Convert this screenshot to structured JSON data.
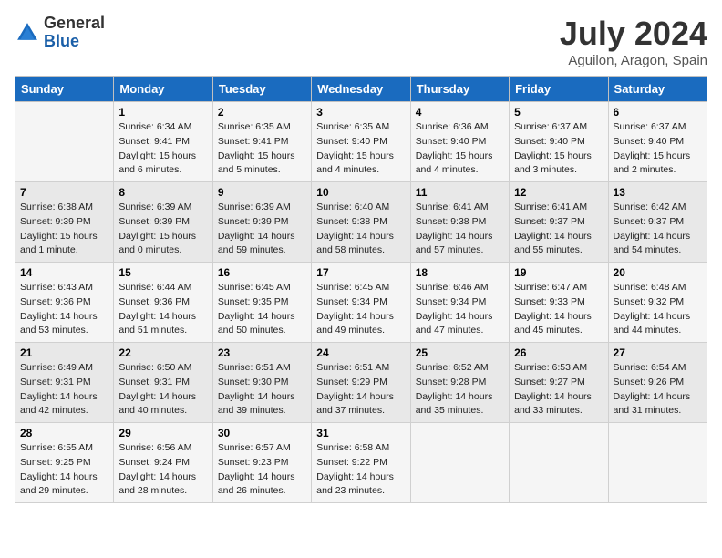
{
  "header": {
    "logo_general": "General",
    "logo_blue": "Blue",
    "month_year": "July 2024",
    "location": "Aguilon, Aragon, Spain"
  },
  "days_of_week": [
    "Sunday",
    "Monday",
    "Tuesday",
    "Wednesday",
    "Thursday",
    "Friday",
    "Saturday"
  ],
  "weeks": [
    [
      {
        "day": "",
        "info": ""
      },
      {
        "day": "1",
        "info": "Sunrise: 6:34 AM\nSunset: 9:41 PM\nDaylight: 15 hours\nand 6 minutes."
      },
      {
        "day": "2",
        "info": "Sunrise: 6:35 AM\nSunset: 9:41 PM\nDaylight: 15 hours\nand 5 minutes."
      },
      {
        "day": "3",
        "info": "Sunrise: 6:35 AM\nSunset: 9:40 PM\nDaylight: 15 hours\nand 4 minutes."
      },
      {
        "day": "4",
        "info": "Sunrise: 6:36 AM\nSunset: 9:40 PM\nDaylight: 15 hours\nand 4 minutes."
      },
      {
        "day": "5",
        "info": "Sunrise: 6:37 AM\nSunset: 9:40 PM\nDaylight: 15 hours\nand 3 minutes."
      },
      {
        "day": "6",
        "info": "Sunrise: 6:37 AM\nSunset: 9:40 PM\nDaylight: 15 hours\nand 2 minutes."
      }
    ],
    [
      {
        "day": "7",
        "info": "Sunrise: 6:38 AM\nSunset: 9:39 PM\nDaylight: 15 hours\nand 1 minute."
      },
      {
        "day": "8",
        "info": "Sunrise: 6:39 AM\nSunset: 9:39 PM\nDaylight: 15 hours\nand 0 minutes."
      },
      {
        "day": "9",
        "info": "Sunrise: 6:39 AM\nSunset: 9:39 PM\nDaylight: 14 hours\nand 59 minutes."
      },
      {
        "day": "10",
        "info": "Sunrise: 6:40 AM\nSunset: 9:38 PM\nDaylight: 14 hours\nand 58 minutes."
      },
      {
        "day": "11",
        "info": "Sunrise: 6:41 AM\nSunset: 9:38 PM\nDaylight: 14 hours\nand 57 minutes."
      },
      {
        "day": "12",
        "info": "Sunrise: 6:41 AM\nSunset: 9:37 PM\nDaylight: 14 hours\nand 55 minutes."
      },
      {
        "day": "13",
        "info": "Sunrise: 6:42 AM\nSunset: 9:37 PM\nDaylight: 14 hours\nand 54 minutes."
      }
    ],
    [
      {
        "day": "14",
        "info": "Sunrise: 6:43 AM\nSunset: 9:36 PM\nDaylight: 14 hours\nand 53 minutes."
      },
      {
        "day": "15",
        "info": "Sunrise: 6:44 AM\nSunset: 9:36 PM\nDaylight: 14 hours\nand 51 minutes."
      },
      {
        "day": "16",
        "info": "Sunrise: 6:45 AM\nSunset: 9:35 PM\nDaylight: 14 hours\nand 50 minutes."
      },
      {
        "day": "17",
        "info": "Sunrise: 6:45 AM\nSunset: 9:34 PM\nDaylight: 14 hours\nand 49 minutes."
      },
      {
        "day": "18",
        "info": "Sunrise: 6:46 AM\nSunset: 9:34 PM\nDaylight: 14 hours\nand 47 minutes."
      },
      {
        "day": "19",
        "info": "Sunrise: 6:47 AM\nSunset: 9:33 PM\nDaylight: 14 hours\nand 45 minutes."
      },
      {
        "day": "20",
        "info": "Sunrise: 6:48 AM\nSunset: 9:32 PM\nDaylight: 14 hours\nand 44 minutes."
      }
    ],
    [
      {
        "day": "21",
        "info": "Sunrise: 6:49 AM\nSunset: 9:31 PM\nDaylight: 14 hours\nand 42 minutes."
      },
      {
        "day": "22",
        "info": "Sunrise: 6:50 AM\nSunset: 9:31 PM\nDaylight: 14 hours\nand 40 minutes."
      },
      {
        "day": "23",
        "info": "Sunrise: 6:51 AM\nSunset: 9:30 PM\nDaylight: 14 hours\nand 39 minutes."
      },
      {
        "day": "24",
        "info": "Sunrise: 6:51 AM\nSunset: 9:29 PM\nDaylight: 14 hours\nand 37 minutes."
      },
      {
        "day": "25",
        "info": "Sunrise: 6:52 AM\nSunset: 9:28 PM\nDaylight: 14 hours\nand 35 minutes."
      },
      {
        "day": "26",
        "info": "Sunrise: 6:53 AM\nSunset: 9:27 PM\nDaylight: 14 hours\nand 33 minutes."
      },
      {
        "day": "27",
        "info": "Sunrise: 6:54 AM\nSunset: 9:26 PM\nDaylight: 14 hours\nand 31 minutes."
      }
    ],
    [
      {
        "day": "28",
        "info": "Sunrise: 6:55 AM\nSunset: 9:25 PM\nDaylight: 14 hours\nand 29 minutes."
      },
      {
        "day": "29",
        "info": "Sunrise: 6:56 AM\nSunset: 9:24 PM\nDaylight: 14 hours\nand 28 minutes."
      },
      {
        "day": "30",
        "info": "Sunrise: 6:57 AM\nSunset: 9:23 PM\nDaylight: 14 hours\nand 26 minutes."
      },
      {
        "day": "31",
        "info": "Sunrise: 6:58 AM\nSunset: 9:22 PM\nDaylight: 14 hours\nand 23 minutes."
      },
      {
        "day": "",
        "info": ""
      },
      {
        "day": "",
        "info": ""
      },
      {
        "day": "",
        "info": ""
      }
    ]
  ]
}
